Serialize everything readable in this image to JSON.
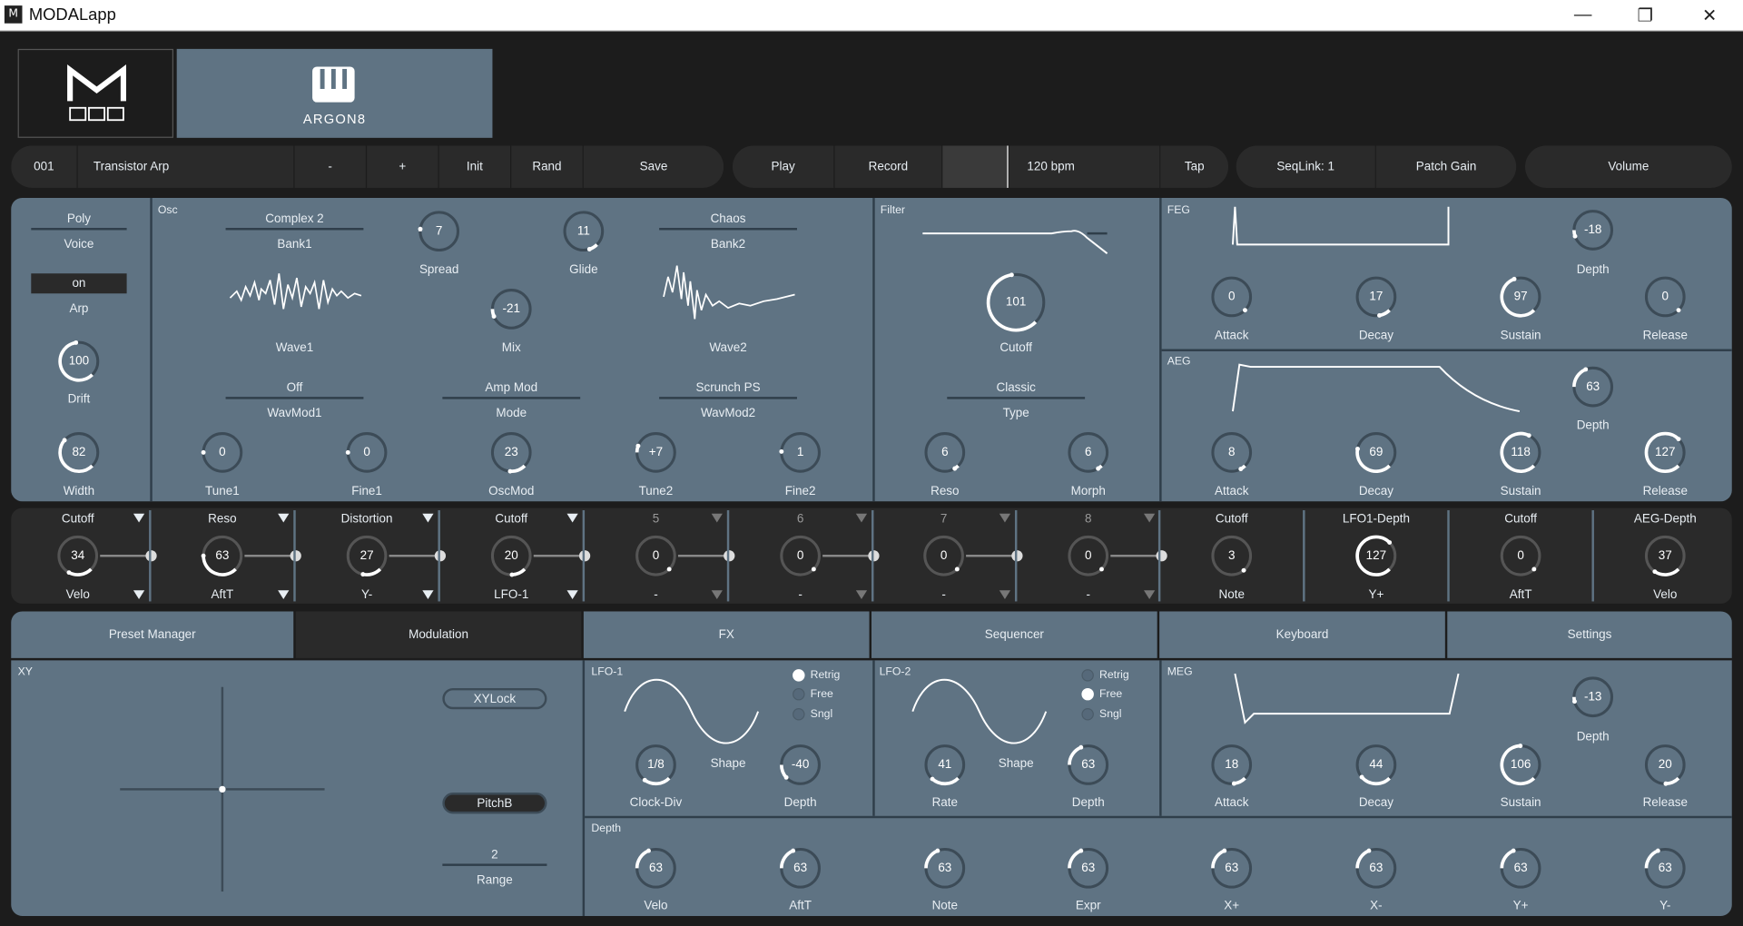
{
  "window": {
    "title": "MODALapp",
    "app_icon": "modal-icon",
    "controls": [
      "minimize-icon",
      "restore-icon",
      "close-icon"
    ]
  },
  "header": {
    "logo": "modal-logo",
    "instrument_label": "ARGON8",
    "instrument_icon": "keyboard-icon"
  },
  "toolbar": {
    "patch_number": "001",
    "patch_name": "Transistor Arp",
    "minus": "-",
    "plus": "+",
    "init": "Init",
    "rand": "Rand",
    "save": "Save",
    "play": "Play",
    "record": "Record",
    "bpm": "120 bpm",
    "tap": "Tap",
    "seqlink": "SeqLink: 1",
    "patch_gain": "Patch Gain",
    "volume": "Volume"
  },
  "voice": {
    "poly": "Poly",
    "voice_label": "Voice",
    "arp_value": "on",
    "arp_label": "Arp",
    "drift_value": "100",
    "drift_label": "Drift",
    "width_value": "82",
    "width_label": "Width"
  },
  "osc": {
    "title": "Osc",
    "wave1_name": "Complex 2",
    "bank1": "Bank1",
    "wave1_label": "Wave1",
    "spread_value": "7",
    "spread_label": "Spread",
    "glide_value": "11",
    "glide_label": "Glide",
    "mix_value": "-21",
    "mix_label": "Mix",
    "wave2_name": "Chaos",
    "bank2": "Bank2",
    "wave2_label": "Wave2",
    "wavmod1_value": "Off",
    "wavmod1_label": "WavMod1",
    "mode_value": "Amp Mod",
    "mode_label": "Mode",
    "wavmod2_value": "Scrunch PS",
    "wavmod2_label": "WavMod2",
    "tune1_value": "0",
    "tune1_label": "Tune1",
    "fine1_value": "0",
    "fine1_label": "Fine1",
    "oscmod_value": "23",
    "oscmod_label": "OscMod",
    "tune2_value": "+7",
    "tune2_label": "Tune2",
    "fine2_value": "1",
    "fine2_label": "Fine2"
  },
  "filter": {
    "title": "Filter",
    "cutoff_value": "101",
    "cutoff_label": "Cutoff",
    "type_value": "Classic",
    "type_label": "Type",
    "reso_value": "6",
    "reso_label": "Reso",
    "morph_value": "6",
    "morph_label": "Morph"
  },
  "feg": {
    "title": "FEG",
    "depth_value": "-18",
    "depth_label": "Depth",
    "attack_value": "0",
    "attack_label": "Attack",
    "decay_value": "17",
    "decay_label": "Decay",
    "sustain_value": "97",
    "sustain_label": "Sustain",
    "release_value": "0",
    "release_label": "Release"
  },
  "aeg": {
    "title": "AEG",
    "depth_value": "63",
    "depth_label": "Depth",
    "attack_value": "8",
    "attack_label": "Attack",
    "decay_value": "69",
    "decay_label": "Decay",
    "sustain_value": "118",
    "sustain_label": "Sustain",
    "release_value": "127",
    "release_label": "Release"
  },
  "modmatrix": {
    "slots": [
      {
        "dest": "Cutoff",
        "value": "34",
        "source": "Velo"
      },
      {
        "dest": "Reso",
        "value": "63",
        "source": "AftT"
      },
      {
        "dest": "Distortion",
        "value": "27",
        "source": "Y-"
      },
      {
        "dest": "Cutoff",
        "value": "20",
        "source": "LFO-1"
      },
      {
        "dest": "5",
        "value": "0",
        "source": "-"
      },
      {
        "dest": "6",
        "value": "0",
        "source": "-"
      },
      {
        "dest": "7",
        "value": "0",
        "source": "-"
      },
      {
        "dest": "8",
        "value": "0",
        "source": "-"
      }
    ],
    "fixed": [
      {
        "dest": "Cutoff",
        "value": "3",
        "source": "Note"
      },
      {
        "dest": "LFO1-Depth",
        "value": "127",
        "source": "Y+"
      },
      {
        "dest": "Cutoff",
        "value": "0",
        "source": "AftT"
      },
      {
        "dest": "AEG-Depth",
        "value": "37",
        "source": "Velo"
      }
    ]
  },
  "tabs": [
    {
      "label": "Preset Manager"
    },
    {
      "label": "Modulation"
    },
    {
      "label": "FX"
    },
    {
      "label": "Sequencer"
    },
    {
      "label": "Keyboard"
    },
    {
      "label": "Settings"
    }
  ],
  "xy": {
    "title": "XY",
    "xylock": "XYLock",
    "pitchb": "PitchB",
    "range_value": "2",
    "range_label": "Range"
  },
  "lfo1": {
    "title": "LFO-1",
    "retrig": "Retrig",
    "free": "Free",
    "sngl": "Sngl",
    "shape": "Shape",
    "clockdiv_value": "1/8",
    "clockdiv_label": "Clock-Div",
    "depth_value": "-40",
    "depth_label": "Depth"
  },
  "lfo2": {
    "title": "LFO-2",
    "retrig": "Retrig",
    "free": "Free",
    "sngl": "Sngl",
    "shape": "Shape",
    "rate_value": "41",
    "rate_label": "Rate",
    "depth_value": "63",
    "depth_label": "Depth"
  },
  "meg": {
    "title": "MEG",
    "depth_value": "-13",
    "depth_label": "Depth",
    "attack_value": "18",
    "attack_label": "Attack",
    "decay_value": "44",
    "decay_label": "Decay",
    "sustain_value": "106",
    "sustain_label": "Sustain",
    "release_value": "20",
    "release_label": "Release"
  },
  "depth": {
    "title": "Depth",
    "knobs": [
      {
        "value": "63",
        "label": "Velo"
      },
      {
        "value": "63",
        "label": "AftT"
      },
      {
        "value": "63",
        "label": "Note"
      },
      {
        "value": "63",
        "label": "Expr"
      },
      {
        "value": "63",
        "label": "X+"
      },
      {
        "value": "63",
        "label": "X-"
      },
      {
        "value": "63",
        "label": "Y+"
      },
      {
        "value": "63",
        "label": "Y-"
      }
    ]
  },
  "colors": {
    "panel": "#5f7383",
    "dark": "#2a2a2a",
    "background": "#1c1c1c",
    "accent": "#ffffff"
  }
}
